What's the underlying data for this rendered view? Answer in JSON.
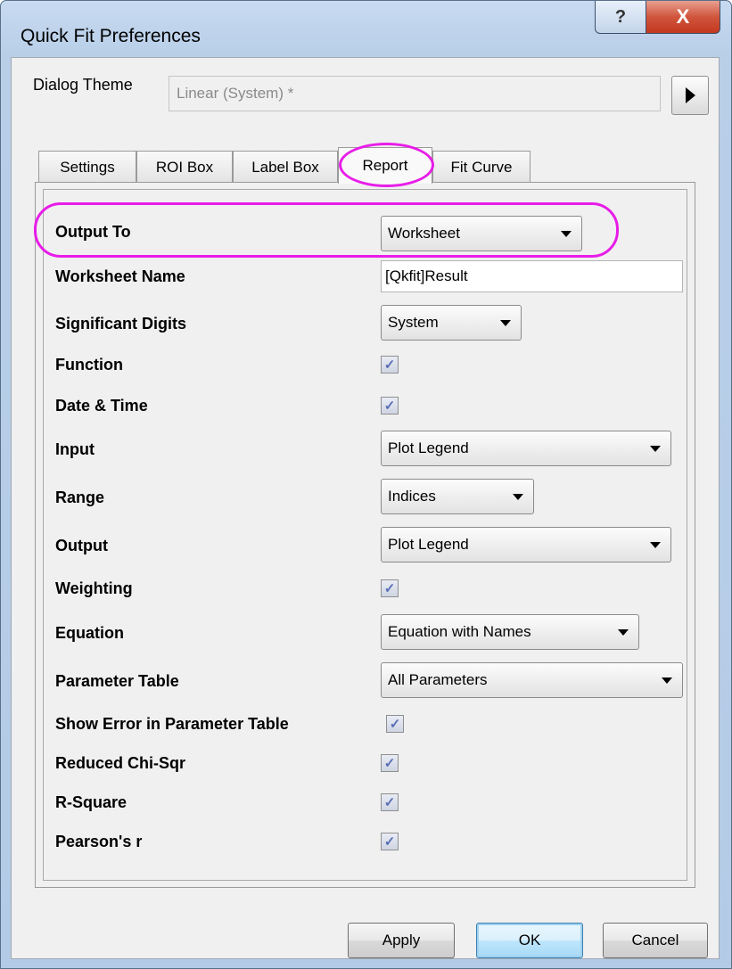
{
  "window": {
    "title": "Quick Fit Preferences",
    "help_icon": "?",
    "close_icon": "X"
  },
  "theme": {
    "label": "Dialog Theme",
    "value": "Linear (System) *"
  },
  "tabs": [
    {
      "label": "Settings"
    },
    {
      "label": "ROI Box"
    },
    {
      "label": "Label Box"
    },
    {
      "label": "Report"
    },
    {
      "label": "Fit Curve"
    }
  ],
  "active_tab": "Report",
  "fields": {
    "output_to": {
      "label": "Output To",
      "value": "Worksheet"
    },
    "worksheet_name": {
      "label": "Worksheet Name",
      "value": "[Qkfit]Result"
    },
    "significant_digits": {
      "label": "Significant Digits",
      "value": "System"
    },
    "function": {
      "label": "Function",
      "checked": true
    },
    "date_time": {
      "label": "Date & Time",
      "checked": true
    },
    "input": {
      "label": "Input",
      "value": "Plot Legend"
    },
    "range": {
      "label": "Range",
      "value": "Indices"
    },
    "output": {
      "label": "Output",
      "value": "Plot Legend"
    },
    "weighting": {
      "label": "Weighting",
      "checked": true
    },
    "equation": {
      "label": "Equation",
      "value": "Equation with Names"
    },
    "parameter_table": {
      "label": "Parameter Table",
      "value": "All Parameters"
    },
    "show_error": {
      "label": "Show Error in Parameter Table",
      "checked": true
    },
    "reduced_chi_sqr": {
      "label": "Reduced Chi-Sqr",
      "checked": true
    },
    "r_square": {
      "label": "R-Square",
      "checked": true
    },
    "pearsons_r": {
      "label": "Pearson's r",
      "checked": true
    }
  },
  "check_glyph": "✓",
  "buttons": {
    "apply": "Apply",
    "ok": "OK",
    "cancel": "Cancel"
  },
  "colors": {
    "highlight": "#e81de8",
    "title_bar": "#b9cfe8",
    "close": "#c2381f"
  }
}
